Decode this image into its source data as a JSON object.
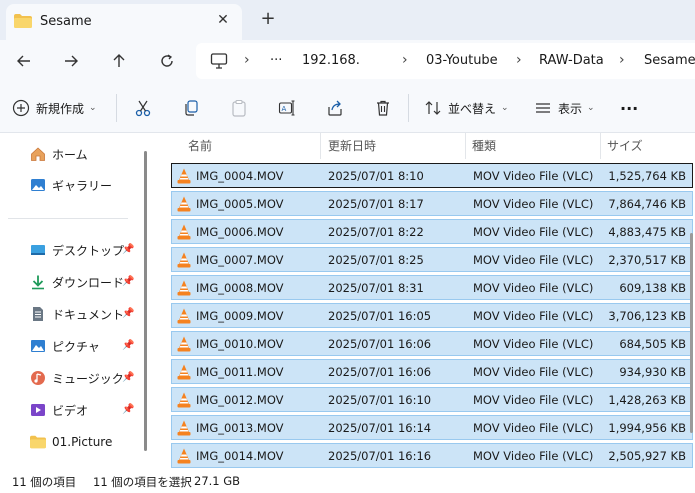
{
  "tab": {
    "title": "Sesame",
    "close": "✕",
    "new_tab": "+"
  },
  "address": {
    "crumbs": [
      "192.168.",
      "03-Youtube",
      "RAW-Data",
      "Sesame"
    ],
    "ellipsis": "···",
    "separator": "›"
  },
  "toolbar": {
    "new_label": "新規作成",
    "sort_label": "並べ替え",
    "view_label": "表示",
    "more": "···"
  },
  "sidebar": {
    "items": [
      {
        "label": "ホーム",
        "icon": "home-icon"
      },
      {
        "label": "ギャラリー",
        "icon": "gallery-icon"
      },
      {
        "label": "デスクトップ",
        "icon": "desktop-icon",
        "pinned": true
      },
      {
        "label": "ダウンロード",
        "icon": "download-icon",
        "pinned": true
      },
      {
        "label": "ドキュメント",
        "icon": "document-icon",
        "pinned": true
      },
      {
        "label": "ピクチャ",
        "icon": "pictures-icon",
        "pinned": true
      },
      {
        "label": "ミュージック",
        "icon": "music-icon",
        "pinned": true
      },
      {
        "label": "ビデオ",
        "icon": "video-icon",
        "pinned": true
      },
      {
        "label": "01.Picture",
        "icon": "folder-icon"
      }
    ]
  },
  "columns": {
    "name": "名前",
    "date": "更新日時",
    "type": "種類",
    "size": "サイズ"
  },
  "files": [
    {
      "name": "IMG_0004.MOV",
      "date": "2025/07/01 8:10",
      "type": "MOV Video File (VLC)",
      "size": "1,525,764 KB"
    },
    {
      "name": "IMG_0005.MOV",
      "date": "2025/07/01 8:17",
      "type": "MOV Video File (VLC)",
      "size": "7,864,746 KB"
    },
    {
      "name": "IMG_0006.MOV",
      "date": "2025/07/01 8:22",
      "type": "MOV Video File (VLC)",
      "size": "4,883,475 KB"
    },
    {
      "name": "IMG_0007.MOV",
      "date": "2025/07/01 8:25",
      "type": "MOV Video File (VLC)",
      "size": "2,370,517 KB"
    },
    {
      "name": "IMG_0008.MOV",
      "date": "2025/07/01 8:31",
      "type": "MOV Video File (VLC)",
      "size": "609,138 KB"
    },
    {
      "name": "IMG_0009.MOV",
      "date": "2025/07/01 16:05",
      "type": "MOV Video File (VLC)",
      "size": "3,706,123 KB"
    },
    {
      "name": "IMG_0010.MOV",
      "date": "2025/07/01 16:06",
      "type": "MOV Video File (VLC)",
      "size": "684,505 KB"
    },
    {
      "name": "IMG_0011.MOV",
      "date": "2025/07/01 16:06",
      "type": "MOV Video File (VLC)",
      "size": "934,930 KB"
    },
    {
      "name": "IMG_0012.MOV",
      "date": "2025/07/01 16:10",
      "type": "MOV Video File (VLC)",
      "size": "1,428,263 KB"
    },
    {
      "name": "IMG_0013.MOV",
      "date": "2025/07/01 16:14",
      "type": "MOV Video File (VLC)",
      "size": "1,994,956 KB"
    },
    {
      "name": "IMG_0014.MOV",
      "date": "2025/07/01 16:16",
      "type": "MOV Video File (VLC)",
      "size": "2,505,927 KB"
    }
  ],
  "status": {
    "item_count": "11 個の項目",
    "selected": "11 個の項目を選択",
    "selected_size": "27.1 GB"
  },
  "colors": {
    "selection_fill": "#cce4f7",
    "selection_border": "#99c9ef",
    "accent": "#0067c0"
  }
}
